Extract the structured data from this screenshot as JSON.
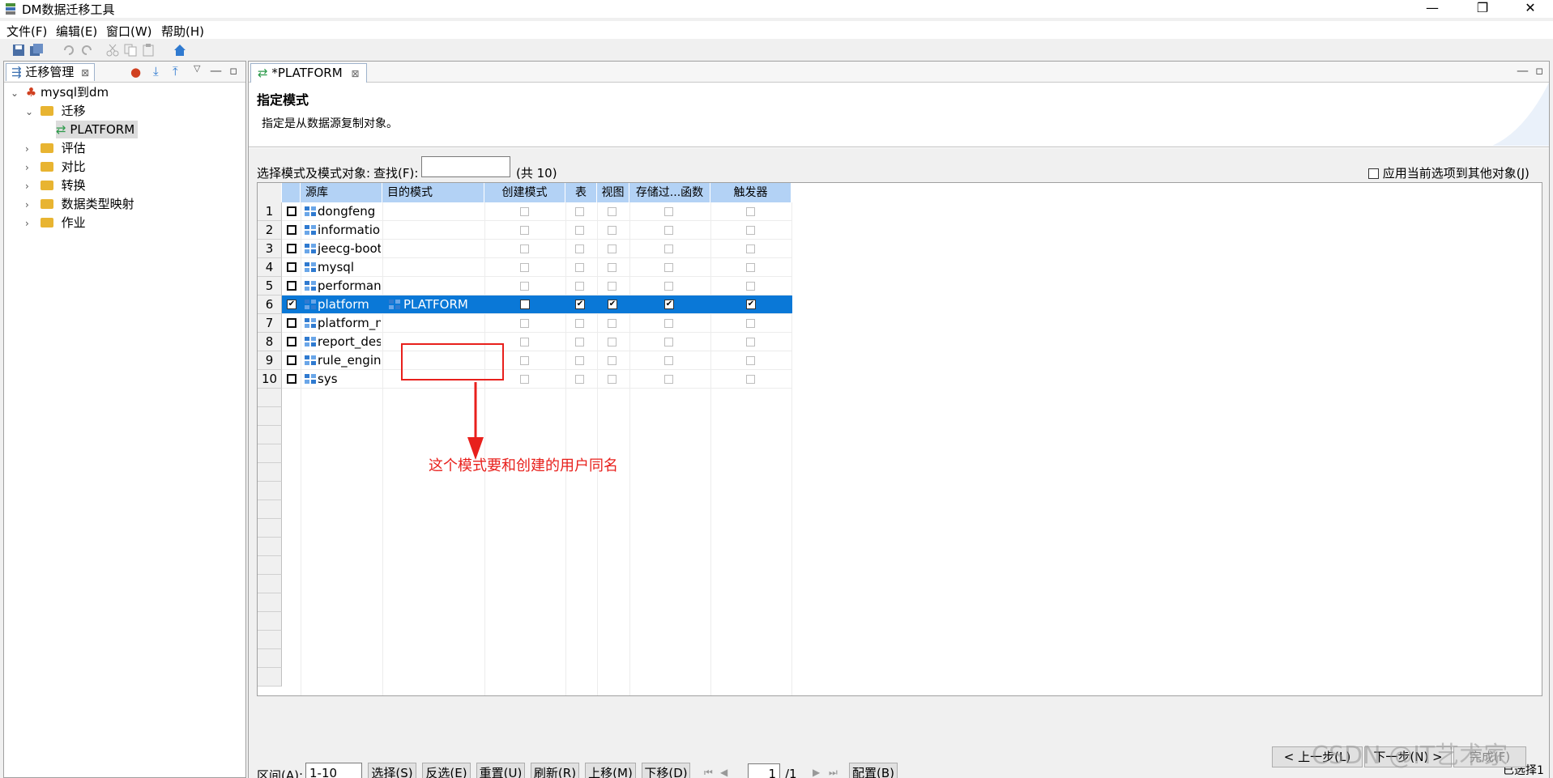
{
  "window": {
    "title": "DM数据迁移工具"
  },
  "menu": [
    "文件(F)",
    "编辑(E)",
    "窗口(W)",
    "帮助(H)"
  ],
  "left_panel": {
    "tab_label": "迁移管理",
    "tree": {
      "root": "mysql到dm",
      "migrate": "迁移",
      "platform": "PLATFORM",
      "assess": "评估",
      "compare": "对比",
      "convert": "转换",
      "type_mapping": "数据类型映射",
      "job": "作业"
    }
  },
  "editor": {
    "tab_label": "*PLATFORM",
    "title": "指定模式",
    "description": "指定是从数据源复制对象。",
    "select_label": "选择模式及模式对象:",
    "find_label": "查找(F):",
    "find_value": "",
    "count_label": "(共 10)",
    "apply_label": "应用当前选项到其他对象(J)",
    "columns": [
      "源库",
      "目的模式",
      "创建模式",
      "表",
      "视图",
      "存储过...函数",
      "触发器"
    ],
    "rows": [
      {
        "num": "1",
        "source": "dongfeng",
        "target": "",
        "checked": false
      },
      {
        "num": "2",
        "source": "information_...",
        "target": "",
        "checked": false
      },
      {
        "num": "3",
        "source": "jeecg-boot",
        "target": "",
        "checked": false
      },
      {
        "num": "4",
        "source": "mysql",
        "target": "",
        "checked": false
      },
      {
        "num": "5",
        "source": "performance...",
        "target": "",
        "checked": false
      },
      {
        "num": "6",
        "source": "platform",
        "target": "PLATFORM",
        "checked": true
      },
      {
        "num": "7",
        "source": "platform_ne...",
        "target": "",
        "checked": false
      },
      {
        "num": "8",
        "source": "report_desig...",
        "target": "",
        "checked": false
      },
      {
        "num": "9",
        "source": "rule_engine",
        "target": "",
        "checked": false
      },
      {
        "num": "10",
        "source": "sys",
        "target": "",
        "checked": false
      }
    ],
    "annotation": "这个模式要和创建的用户同名",
    "footer": {
      "range_label": "区间(A):",
      "range_value": "1-10",
      "select": "选择(S)",
      "invert": "反选(E)",
      "reset": "重置(U)",
      "refresh": "刷新(R)",
      "up": "上移(M)",
      "down": "下移(D)",
      "page_value": "1",
      "page_total": "/1",
      "config": "配置(B)",
      "selected_count": "已选择1",
      "prev": "< 上一步(L)",
      "next": "下一步(N) >",
      "finish": "完成(F)",
      "watermark": "CSDN @IT艺术家"
    }
  }
}
